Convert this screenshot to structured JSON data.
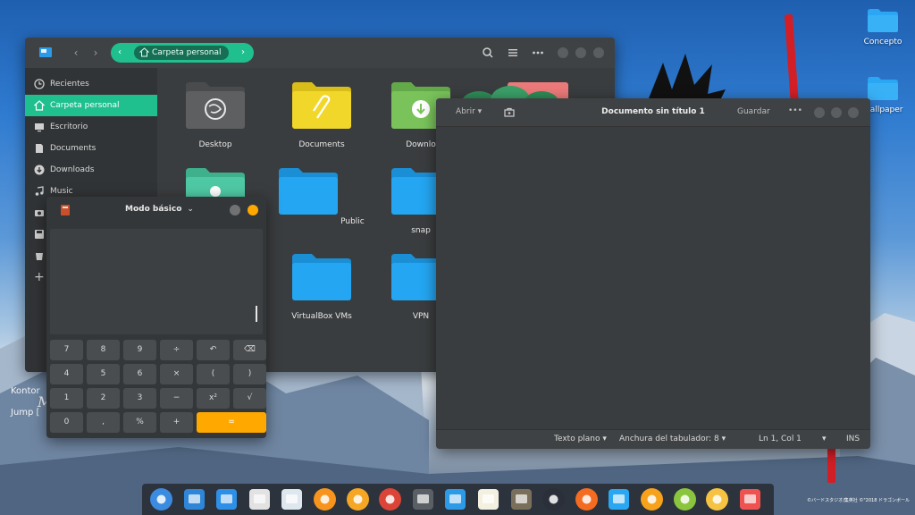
{
  "desktop": {
    "icons": [
      {
        "label": "Concepto",
        "icon": "folder-icon"
      },
      {
        "label": "Wallpaper",
        "icon": "folder-icon"
      }
    ],
    "wall_text": {
      "line1": "Kontor",
      "line2": "M",
      "line3": "Jump ["
    },
    "copyright": "©バードスタジオ/集英社 ©\"2018 ドラゴンボール"
  },
  "file_manager": {
    "path_crumb": "Carpeta personal",
    "sidebar": {
      "items": [
        {
          "label": "Recientes",
          "icon": "clock-icon"
        },
        {
          "label": "Carpeta personal",
          "icon": "home-icon",
          "active": true
        },
        {
          "label": "Escritorio",
          "icon": "desktop-icon"
        },
        {
          "label": "Documents",
          "icon": "document-icon"
        },
        {
          "label": "Downloads",
          "icon": "download-icon"
        },
        {
          "label": "Music",
          "icon": "music-icon"
        }
      ],
      "add_label": "+"
    },
    "folders": [
      {
        "label": "Desktop",
        "color": "#5e5f61",
        "emblem": "deepin-logo-icon"
      },
      {
        "label": "Documents",
        "color": "#f2d72b",
        "emblem": "paperclip-icon"
      },
      {
        "label": "Downlo",
        "color": "#7ac35b",
        "emblem": "download-icon"
      },
      {
        "label": "",
        "color": "#4fc9a4",
        "emblem": "flower-icon"
      },
      {
        "label": "Public",
        "color": "#24a6f2",
        "emblem": ""
      },
      {
        "label": "snap",
        "color": "#24a6f2",
        "emblem": ""
      },
      {
        "label": "",
        "color": "#24a6f2",
        "emblem": ""
      },
      {
        "label": "VirtualBox VMs",
        "color": "#24a6f2",
        "emblem": ""
      },
      {
        "label": "VPN",
        "color": "#24a6f2",
        "emblem": ""
      }
    ]
  },
  "calculator": {
    "mode": "Modo básico",
    "keys": [
      {
        "label": "7"
      },
      {
        "label": "8"
      },
      {
        "label": "9"
      },
      {
        "label": "÷"
      },
      {
        "label": "↶"
      },
      {
        "label": "⌫"
      },
      {
        "label": "4"
      },
      {
        "label": "5"
      },
      {
        "label": "6"
      },
      {
        "label": "×"
      },
      {
        "label": "("
      },
      {
        "label": ")"
      },
      {
        "label": "1"
      },
      {
        "label": "2"
      },
      {
        "label": "3"
      },
      {
        "label": "−"
      },
      {
        "label": "x²"
      },
      {
        "label": "√"
      },
      {
        "label": "0"
      },
      {
        "label": ","
      },
      {
        "label": "%"
      },
      {
        "label": "+"
      },
      {
        "label": "=",
        "accent": true
      }
    ],
    "accent_color": "#ffa800"
  },
  "editor": {
    "open_label": "Abrir",
    "title": "Documento sin título 1",
    "save_label": "Guardar",
    "more_label": "•••",
    "status": {
      "language": "Texto plano",
      "tab_width": "Anchura del tabulador: 8",
      "position": "Ln 1, Col 1",
      "mode": "INS"
    }
  },
  "dock": {
    "apps": [
      {
        "icon": "launcher-rocket-icon",
        "color": "#3b8be0"
      },
      {
        "icon": "image-viewer-icon",
        "color": "#2f86d8"
      },
      {
        "icon": "workspaces-icon",
        "color": "#2e8fe6"
      },
      {
        "icon": "file-manager-icon",
        "color": "#e2e2e2"
      },
      {
        "icon": "screenshot-icon",
        "color": "#dfe7ee"
      },
      {
        "icon": "orange-app-icon",
        "color": "#f7941d"
      },
      {
        "icon": "media-player-icon",
        "color": "#f5a623"
      },
      {
        "icon": "chrome-icon",
        "color": "#db4437"
      },
      {
        "icon": "settings-icon",
        "color": "#5a5f66"
      },
      {
        "icon": "finder-icon",
        "color": "#2d9ae8"
      },
      {
        "icon": "text-editor-icon",
        "color": "#f3f0e2"
      },
      {
        "icon": "calculator-icon",
        "color": "#7a6f5a"
      },
      {
        "icon": "music-player-icon",
        "color": "#2b2f3a"
      },
      {
        "icon": "eject-icon",
        "color": "#f36c21"
      },
      {
        "icon": "wifi-icon",
        "color": "#2aa7f2"
      },
      {
        "icon": "power-icon",
        "color": "#f7a21b"
      },
      {
        "icon": "battery-icon",
        "color": "#8bc53f"
      },
      {
        "icon": "clock-app-icon",
        "color": "#f5c242"
      },
      {
        "icon": "trash-icon",
        "color": "#ef5350"
      }
    ]
  },
  "colors": {
    "accent_green": "#1fc08e",
    "calculator_orange": "#ffa800"
  }
}
